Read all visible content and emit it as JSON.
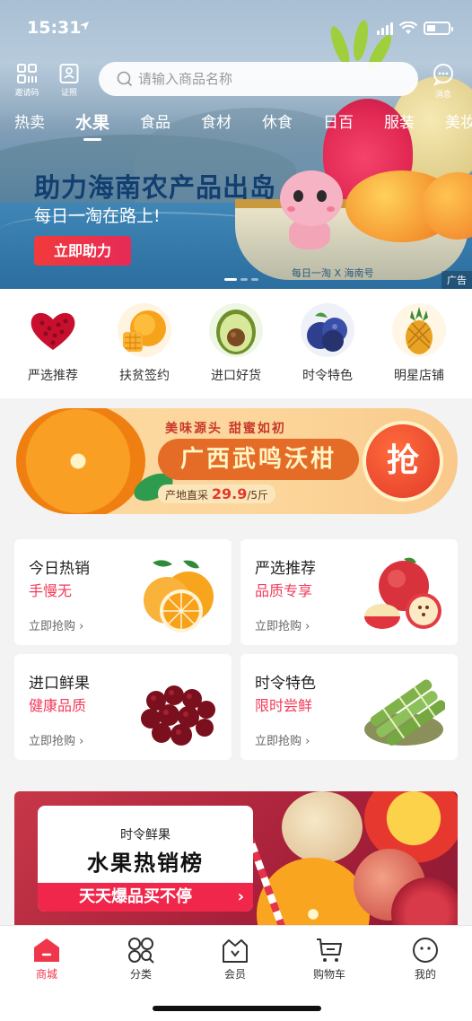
{
  "status": {
    "time": "15:31"
  },
  "header": {
    "left_icons": [
      {
        "label": "邀请码",
        "icon": "invite-code-icon"
      },
      {
        "label": "证照",
        "icon": "license-icon"
      }
    ],
    "message": {
      "label": "消息",
      "icon": "message-icon"
    },
    "search": {
      "placeholder": "请输入商品名称"
    }
  },
  "tabs": [
    {
      "label": "热卖",
      "active": false
    },
    {
      "label": "水果",
      "active": true
    },
    {
      "label": "食品",
      "active": false
    },
    {
      "label": "食材",
      "active": false
    },
    {
      "label": "休食",
      "active": false
    },
    {
      "label": "日百",
      "active": false
    },
    {
      "label": "服装",
      "active": false
    },
    {
      "label": "美妆",
      "active": false
    }
  ],
  "hero": {
    "title": "助力海南农产品出岛",
    "subtitle": "每日一淘在路上!",
    "button": "立即助力",
    "ad_tag": "广告",
    "boat_text": "每日一淘 X 海南号",
    "slide_count": 3,
    "active_slide": 1
  },
  "categories": [
    {
      "label": "严选推荐",
      "icon": "heart-fruit-icon"
    },
    {
      "label": "扶贫签约",
      "icon": "mango-icon"
    },
    {
      "label": "进口好货",
      "icon": "avocado-icon"
    },
    {
      "label": "时令特色",
      "icon": "blueberry-icon"
    },
    {
      "label": "明星店铺",
      "icon": "pineapple-icon"
    }
  ],
  "promo": {
    "tagline": "美味源头 甜蜜如初",
    "title": "广西武鸣沃柑",
    "price_prefix": "产地直采",
    "price": "29.9",
    "price_unit": "/5斤",
    "grab": "抢"
  },
  "cards": [
    {
      "title": "今日热销",
      "subtitle": "手慢无",
      "button": "立即抢购",
      "icon": "orange-icon"
    },
    {
      "title": "严选推荐",
      "subtitle": "品质专享",
      "button": "立即抢购",
      "icon": "apple-icon"
    },
    {
      "title": "进口鲜果",
      "subtitle": "健康品质",
      "button": "立即抢购",
      "icon": "cherry-icon"
    },
    {
      "title": "时令特色",
      "subtitle": "限时尝鲜",
      "button": "立即抢购",
      "icon": "sugarcane-icon"
    }
  ],
  "ranking": {
    "subtitle": "时令鲜果",
    "title": "水果热销榜",
    "bar": "天天爆品买不停"
  },
  "nav": [
    {
      "label": "商城",
      "icon": "mall-icon",
      "active": true
    },
    {
      "label": "分类",
      "icon": "category-icon",
      "active": false
    },
    {
      "label": "会员",
      "icon": "member-icon",
      "active": false
    },
    {
      "label": "购物车",
      "icon": "cart-icon",
      "active": false
    },
    {
      "label": "我的",
      "icon": "profile-icon",
      "active": false
    }
  ],
  "colors": {
    "accent": "#f0364a",
    "hero_title": "#123f70",
    "promo_main": "#e46c27"
  }
}
